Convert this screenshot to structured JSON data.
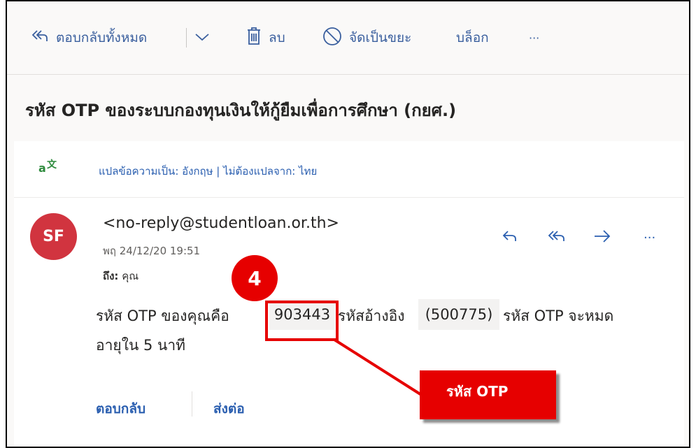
{
  "toolbar": {
    "reply_all": "ตอบกลับทั้งหมด",
    "delete": "ลบ",
    "junk": "จัดเป็นขยะ",
    "block": "บล็อก",
    "more": "···"
  },
  "subject": "รหัส OTP ของระบบกองทุนเงินให้กู้ยืมเพื่อการศึกษา (กยศ.)",
  "translate": {
    "text": "แปลข้อความเป็น: อังกฤษ | ไม่ต้องแปลจาก: ไทย"
  },
  "message": {
    "avatar_initials": "SF",
    "sender": "<no-reply@studentloan.or.th>",
    "date": "พฤ 24/12/20 19:51",
    "to_label": "ถึง:",
    "to_value": "คุณ",
    "body_prefix": "รหัส OTP ของคุณคือ",
    "otp_code": "903443",
    "body_middle": "รหัสอ้างอิง",
    "ref_code": "(500775)",
    "body_suffix": "รหัส OTP จะหมด",
    "body_line2": "อายุใน 5 นาที",
    "reply_label": "ตอบกลับ",
    "forward_label": "ส่งต่อ",
    "more": "···"
  },
  "annotation": {
    "step_number": "4",
    "callout_label": "รหัส OTP",
    "accent_color": "#e60000"
  },
  "colors": {
    "link_blue": "#2b5fb0",
    "avatar_red": "#d1343f"
  }
}
